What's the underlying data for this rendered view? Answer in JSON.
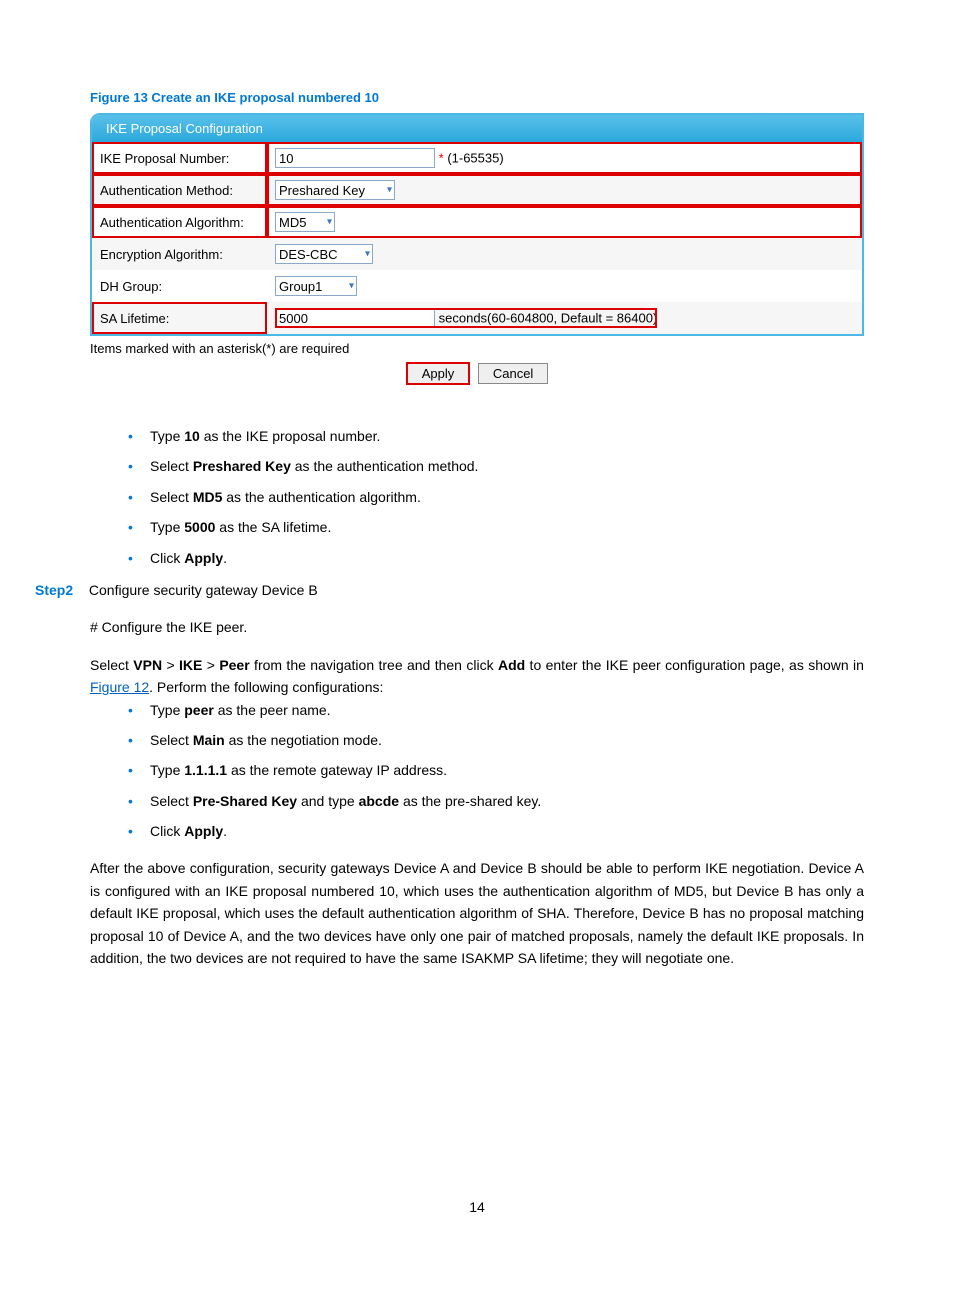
{
  "figure_caption": "Figure 13 Create an IKE proposal numbered 10",
  "panel": {
    "header": "IKE Proposal Configuration",
    "rows": {
      "proposal_number": {
        "label": "IKE Proposal Number:",
        "value": "10",
        "hint": "(1-65535)"
      },
      "auth_method": {
        "label": "Authentication Method:",
        "value": "Preshared Key"
      },
      "auth_algo": {
        "label": "Authentication Algorithm:",
        "value": "MD5"
      },
      "enc_algo": {
        "label": "Encryption Algorithm:",
        "value": "DES-CBC"
      },
      "dh_group": {
        "label": "DH Group:",
        "value": "Group1"
      },
      "sa_lifetime": {
        "label": "SA Lifetime:",
        "value": "5000",
        "hint": "seconds(60-604800, Default = 86400)"
      }
    },
    "required_note": "Items marked with an asterisk(*) are required",
    "apply": "Apply",
    "cancel": "Cancel"
  },
  "list1": {
    "i1_a": "Type ",
    "i1_b": "10",
    "i1_c": " as the IKE proposal number.",
    "i2_a": "Select ",
    "i2_b": "Preshared Key",
    "i2_c": " as the authentication method.",
    "i3_a": "Select ",
    "i3_b": "MD5",
    "i3_c": " as the authentication algorithm.",
    "i4_a": "Type ",
    "i4_b": "5000",
    "i4_c": " as the SA lifetime.",
    "i5_a": "Click ",
    "i5_b": "Apply",
    "i5_c": "."
  },
  "step2": {
    "label": "Step2",
    "text": "Configure security gateway Device B"
  },
  "para1": "# Configure the IKE peer.",
  "para2_a": "Select ",
  "para2_vpn": "VPN",
  "para2_gt1": " > ",
  "para2_ike": "IKE",
  "para2_gt2": " > ",
  "para2_peer": "Peer",
  "para2_mid": " from the navigation tree and then click ",
  "para2_add": "Add",
  "para2_end1": " to enter the IKE peer configuration page, as shown in ",
  "para2_link": "Figure 12",
  "para2_end2": ". Perform the following configurations:",
  "list2": {
    "i1_a": "Type ",
    "i1_b": "peer",
    "i1_c": " as the peer name.",
    "i2_a": "Select ",
    "i2_b": "Main",
    "i2_c": " as the negotiation mode.",
    "i3_a": "Type ",
    "i3_b": "1.1.1.1",
    "i3_c": " as the remote gateway IP address.",
    "i4_a": "Select ",
    "i4_b": "Pre-Shared Key",
    "i4_c": " and type ",
    "i4_d": "abcde",
    "i4_e": " as the pre-shared key.",
    "i5_a": "Click ",
    "i5_b": "Apply",
    "i5_c": "."
  },
  "para3": "After the above configuration, security gateways Device A and Device B should be able to perform IKE negotiation. Device A is configured with an IKE proposal numbered 10, which uses the authentication algorithm of MD5, but Device B has only a default IKE proposal, which uses the default authentication algorithm of SHA. Therefore, Device B has no proposal matching proposal 10 of Device A, and the two devices have only one pair of matched proposals, namely the default IKE proposals. In addition, the two devices are not required to have the same ISAKMP SA lifetime; they will negotiate one.",
  "page_number": "14"
}
